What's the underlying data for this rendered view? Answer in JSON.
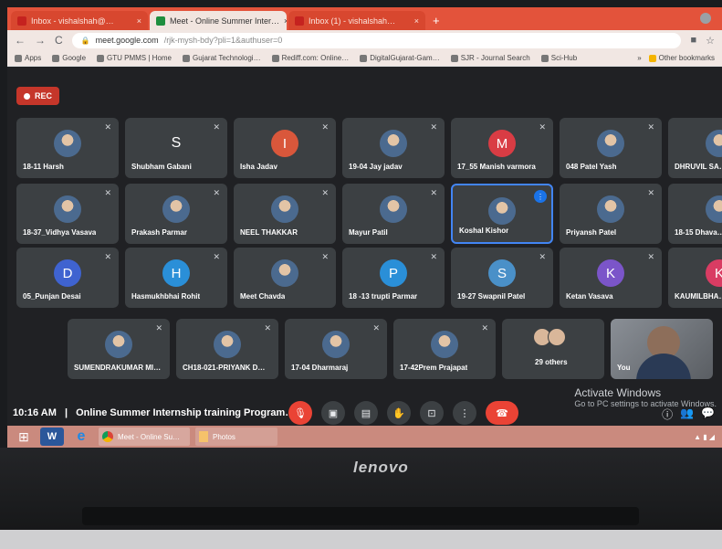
{
  "browser": {
    "tabs": [
      {
        "label": "Inbox - vishalshah@…",
        "active": false
      },
      {
        "label": "Meet - Online Summer Inter…",
        "active": true
      },
      {
        "label": "Inbox (1) - vishalshah…",
        "active": false
      }
    ],
    "new_tab": "+",
    "url_host": "meet.google.com",
    "url_path": "/rjk-mysh-bdy?pli=1&authuser=0",
    "bookmarks": [
      "Apps",
      "Google",
      "GTU PMMS | Home",
      "Gujarat Technologi…",
      "Rediff.com: Online…",
      "DigitalGujarat-Gam…",
      "SJR - Journal Search",
      "Sci-Hub"
    ],
    "other_bookmarks": "Other bookmarks"
  },
  "meet": {
    "rec_label": "REC",
    "participants": [
      {
        "name": "18-11 Harsh",
        "type": "photo"
      },
      {
        "name": "Shubham Gabani",
        "type": "letter",
        "letter": "S",
        "color": ""
      },
      {
        "name": "Isha Jadav",
        "type": "letter",
        "letter": "I",
        "color": "#d9573b"
      },
      {
        "name": "19-04 Jay jadav",
        "type": "photo"
      },
      {
        "name": "17_55 Manish varmora",
        "type": "letter",
        "letter": "M",
        "color": "#d93c44"
      },
      {
        "name": "048 Patel Yash",
        "type": "photo"
      },
      {
        "name": "DHRUVIL SA…",
        "type": "photo"
      },
      {
        "name": "18-37_Vidhya Vasava",
        "type": "photo"
      },
      {
        "name": "Prakash Parmar",
        "type": "photo"
      },
      {
        "name": "NEEL THAKKAR",
        "type": "photo"
      },
      {
        "name": "Mayur Patil",
        "type": "photo"
      },
      {
        "name": "Koshal Kishor",
        "type": "photo",
        "highlight": true
      },
      {
        "name": "Priyansh Patel",
        "type": "photo"
      },
      {
        "name": "18-15 Dhava…",
        "type": "photo"
      },
      {
        "name": "05_Punjan Desai",
        "type": "letter",
        "letter": "D",
        "color": "#3f63d0"
      },
      {
        "name": "Hasmukhbhai Rohit",
        "type": "letter",
        "letter": "H",
        "color": "#2a8fd8"
      },
      {
        "name": "Meet Chavda",
        "type": "photo"
      },
      {
        "name": "18 -13 trupti Parmar",
        "type": "letter",
        "letter": "P",
        "color": "#2a8fd8"
      },
      {
        "name": "19-27 Swapnil Patel",
        "type": "letter",
        "letter": "S",
        "color": "#4a90c8"
      },
      {
        "name": "Ketan Vasava",
        "type": "letter",
        "letter": "K",
        "color": "#7b55c9"
      },
      {
        "name": "KAUMILBHA…",
        "type": "letter",
        "letter": "K",
        "color": "#d93c63"
      },
      {
        "name": "SUMENDRAKUMAR MI…",
        "type": "photo"
      },
      {
        "name": "CH18-021-PRIYANK D…",
        "type": "photo"
      },
      {
        "name": "17-04 Dharmaraj",
        "type": "photo"
      },
      {
        "name": "17-42Prem Prajapat",
        "type": "photo"
      },
      {
        "name": "29 others",
        "type": "others"
      },
      {
        "name": "You",
        "type": "self"
      }
    ],
    "time": "10:16 AM",
    "separator": "|",
    "meeting_title": "Online Summer Internship training Program…",
    "activate_title": "Activate Windows",
    "activate_sub": "Go to PC settings to activate Windows."
  },
  "taskbar": {
    "chrome_label": "Meet - Online Su…",
    "photos_label": "Photos"
  },
  "laptop": {
    "brand": "lenovo"
  }
}
